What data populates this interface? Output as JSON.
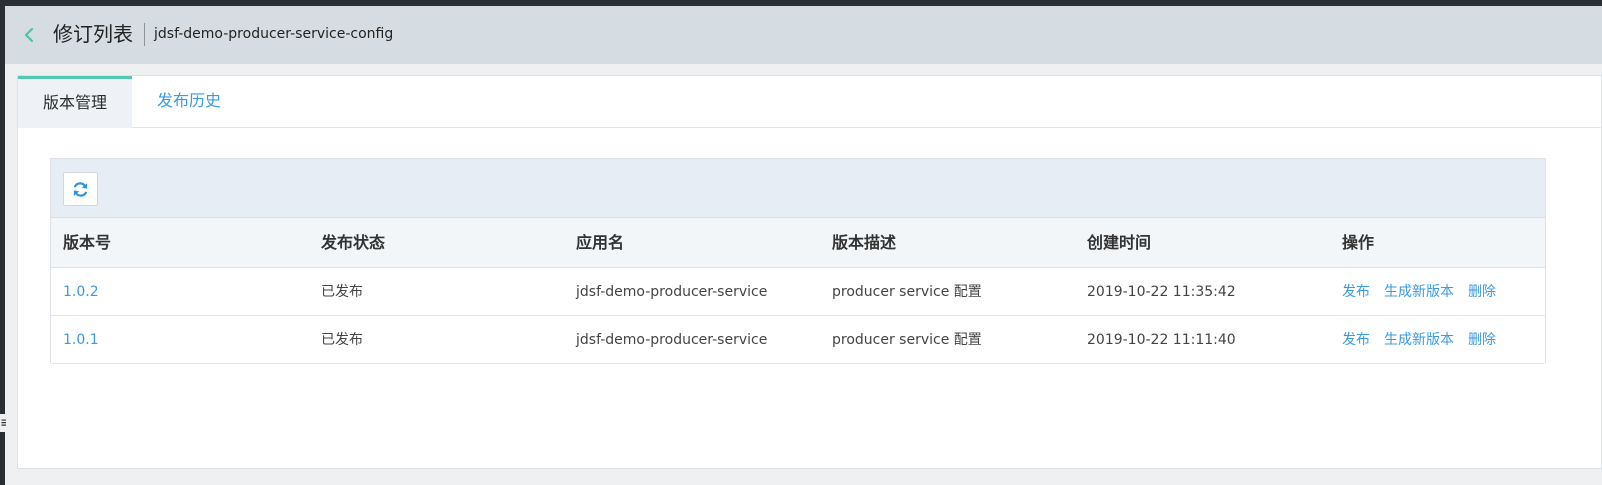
{
  "header": {
    "back_icon": "chevron-left-icon",
    "title": "修订列表",
    "config_name": "jdsf-demo-producer-service-config"
  },
  "tabs": [
    {
      "label": "版本管理",
      "active": true
    },
    {
      "label": "发布历史",
      "active": false
    }
  ],
  "toolbar": {
    "refresh_icon": "refresh-icon"
  },
  "table": {
    "columns": [
      "版本号",
      "发布状态",
      "应用名",
      "版本描述",
      "创建时间",
      "操作"
    ],
    "rows": [
      {
        "version": "1.0.2",
        "status": "已发布",
        "app": "jdsf-demo-producer-service",
        "desc": "producer service 配置",
        "created": "2019-10-22 11:35:42",
        "actions": [
          "发布",
          "生成新版本",
          "删除"
        ]
      },
      {
        "version": "1.0.1",
        "status": "已发布",
        "app": "jdsf-demo-producer-service",
        "desc": "producer service 配置",
        "created": "2019-10-22 11:11:40",
        "actions": [
          "发布",
          "生成新版本",
          "删除"
        ]
      }
    ]
  },
  "colors": {
    "accent": "#3a9be0",
    "tab_indicator": "#54c8b0",
    "header_bg": "#d6dde2"
  }
}
